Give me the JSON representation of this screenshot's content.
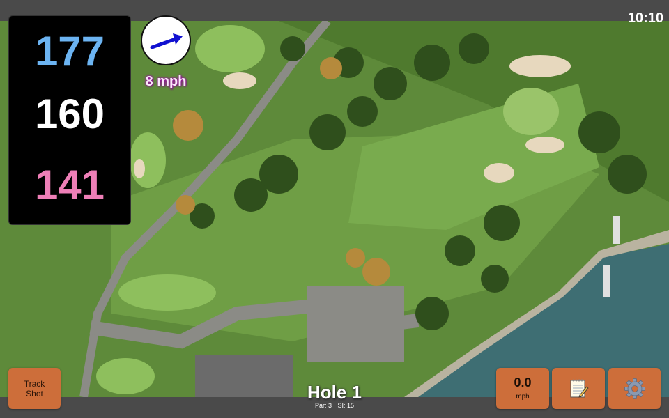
{
  "status": {
    "clock": "10:10"
  },
  "distances": {
    "back": "177",
    "middle": "160",
    "front": "141"
  },
  "wind": {
    "speed_label": "8 mph",
    "direction_icon": "wind-arrow-icon"
  },
  "hole": {
    "title": "Hole 1",
    "par": "Par: 3",
    "stroke_index": "SI: 15"
  },
  "buttons": {
    "track_shot_line1": "Track",
    "track_shot_line2": "Shot",
    "speed_value": "0.0",
    "speed_unit": "mph",
    "notes_icon": "notepad-icon",
    "settings_icon": "gear-icon"
  },
  "colors": {
    "back_distance": "#6cb4f2",
    "middle_distance": "#ffffff",
    "front_distance": "#ee7fb7",
    "button_bg": "#cd6e3a",
    "wind_arrow": "#1010d0"
  }
}
